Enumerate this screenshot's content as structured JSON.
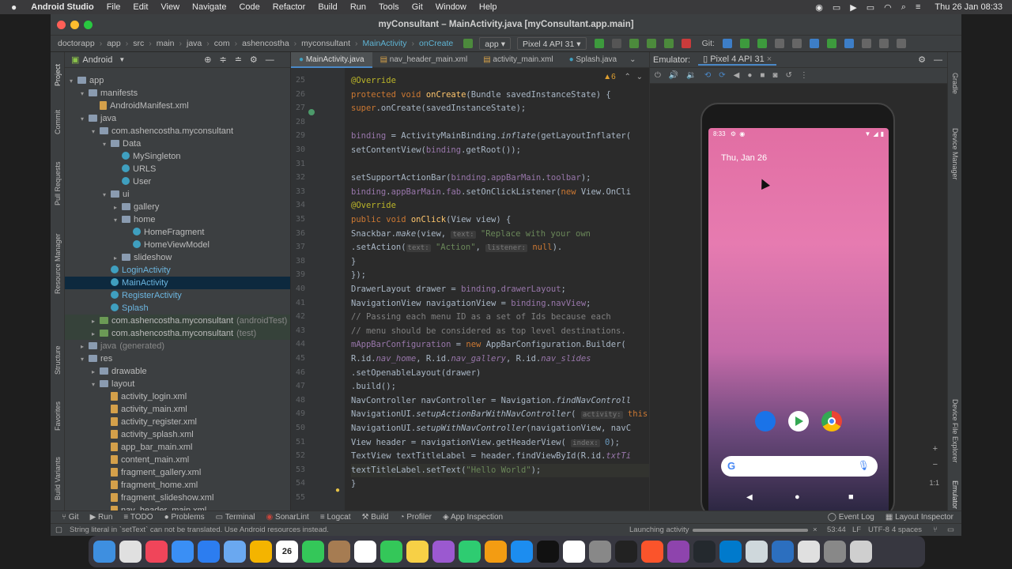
{
  "menubar": {
    "app_name": "Android Studio",
    "items": [
      "File",
      "Edit",
      "View",
      "Navigate",
      "Code",
      "Refactor",
      "Build",
      "Run",
      "Tools",
      "Git",
      "Window",
      "Help"
    ],
    "clock": "Thu 26 Jan  08:33"
  },
  "window": {
    "title": "myConsultant – MainActivity.java [myConsultant.app.main]"
  },
  "navbar": {
    "crumbs": [
      "doctorapp",
      "app",
      "src",
      "main",
      "java",
      "com",
      "ashencostha",
      "myconsultant",
      "MainActivity",
      "onCreate"
    ],
    "run_config": "app",
    "device": "Pixel 4 API 31",
    "git_label": "Git:"
  },
  "left_strip": {
    "tabs": [
      "Project",
      "Commit",
      "Pull Requests",
      "Resource Manager",
      "Structure",
      "Favorites",
      "Build Variants"
    ]
  },
  "right_strip": {
    "tabs": [
      "Gradle",
      "Device Manager",
      "Device File Explorer",
      "Emulator"
    ]
  },
  "project": {
    "view_mode": "Android",
    "tree": [
      {
        "label": "app",
        "indent": 0,
        "arrow": "▾",
        "icon": "folder",
        "state": ""
      },
      {
        "label": "manifests",
        "indent": 1,
        "arrow": "▾",
        "icon": "folder",
        "state": ""
      },
      {
        "label": "AndroidManifest.xml",
        "indent": 2,
        "arrow": "",
        "icon": "xml",
        "state": ""
      },
      {
        "label": "java",
        "indent": 1,
        "arrow": "▾",
        "icon": "folder",
        "state": ""
      },
      {
        "label": "com.ashencostha.myconsultant",
        "indent": 2,
        "arrow": "▾",
        "icon": "folder",
        "state": ""
      },
      {
        "label": "Data",
        "indent": 3,
        "arrow": "▾",
        "icon": "folder",
        "state": ""
      },
      {
        "label": "MySingleton",
        "indent": 4,
        "arrow": "",
        "icon": "class",
        "state": ""
      },
      {
        "label": "URLS",
        "indent": 4,
        "arrow": "",
        "icon": "class",
        "state": ""
      },
      {
        "label": "User",
        "indent": 4,
        "arrow": "",
        "icon": "class",
        "state": ""
      },
      {
        "label": "ui",
        "indent": 3,
        "arrow": "▾",
        "icon": "folder",
        "state": ""
      },
      {
        "label": "gallery",
        "indent": 4,
        "arrow": "▸",
        "icon": "folder",
        "state": ""
      },
      {
        "label": "home",
        "indent": 4,
        "arrow": "▾",
        "icon": "folder",
        "state": ""
      },
      {
        "label": "HomeFragment",
        "indent": 5,
        "arrow": "",
        "icon": "class",
        "state": ""
      },
      {
        "label": "HomeViewModel",
        "indent": 5,
        "arrow": "",
        "icon": "class",
        "state": ""
      },
      {
        "label": "slideshow",
        "indent": 4,
        "arrow": "▸",
        "icon": "folder",
        "state": ""
      },
      {
        "label": "LoginActivity",
        "indent": 3,
        "arrow": "",
        "icon": "class",
        "state": ""
      },
      {
        "label": "MainActivity",
        "indent": 3,
        "arrow": "",
        "icon": "class",
        "state": "sel"
      },
      {
        "label": "RegisterActivity",
        "indent": 3,
        "arrow": "",
        "icon": "class",
        "state": ""
      },
      {
        "label": "Splash",
        "indent": 3,
        "arrow": "",
        "icon": "class",
        "state": ""
      },
      {
        "label": "com.ashencostha.myconsultant",
        "suffix": "(androidTest)",
        "indent": 2,
        "arrow": "▸",
        "icon": "folder",
        "state": "test"
      },
      {
        "label": "com.ashencostha.myconsultant",
        "suffix": "(test)",
        "indent": 2,
        "arrow": "▸",
        "icon": "folder",
        "state": "test"
      },
      {
        "label": "java",
        "suffix": "(generated)",
        "indent": 1,
        "arrow": "▸",
        "icon": "folder",
        "state": "gen"
      },
      {
        "label": "res",
        "indent": 1,
        "arrow": "▾",
        "icon": "folder",
        "state": ""
      },
      {
        "label": "drawable",
        "indent": 2,
        "arrow": "▸",
        "icon": "folder",
        "state": ""
      },
      {
        "label": "layout",
        "indent": 2,
        "arrow": "▾",
        "icon": "folder",
        "state": ""
      },
      {
        "label": "activity_login.xml",
        "indent": 3,
        "arrow": "",
        "icon": "xml",
        "state": ""
      },
      {
        "label": "activity_main.xml",
        "indent": 3,
        "arrow": "",
        "icon": "xml",
        "state": ""
      },
      {
        "label": "activity_register.xml",
        "indent": 3,
        "arrow": "",
        "icon": "xml",
        "state": ""
      },
      {
        "label": "activity_splash.xml",
        "indent": 3,
        "arrow": "",
        "icon": "xml",
        "state": ""
      },
      {
        "label": "app_bar_main.xml",
        "indent": 3,
        "arrow": "",
        "icon": "xml",
        "state": ""
      },
      {
        "label": "content_main.xml",
        "indent": 3,
        "arrow": "",
        "icon": "xml",
        "state": ""
      },
      {
        "label": "fragment_gallery.xml",
        "indent": 3,
        "arrow": "",
        "icon": "xml",
        "state": ""
      },
      {
        "label": "fragment_home.xml",
        "indent": 3,
        "arrow": "",
        "icon": "xml",
        "state": ""
      },
      {
        "label": "fragment_slideshow.xml",
        "indent": 3,
        "arrow": "",
        "icon": "xml",
        "state": ""
      },
      {
        "label": "nav_header_main.xml",
        "indent": 3,
        "arrow": "",
        "icon": "xml",
        "state": ""
      }
    ]
  },
  "editor": {
    "tabs": [
      {
        "label": "MainActivity.java",
        "active": true
      },
      {
        "label": "nav_header_main.xml",
        "active": false
      },
      {
        "label": "activity_main.xml",
        "active": false
      },
      {
        "label": "Splash.java",
        "active": false
      }
    ],
    "warnings": "6",
    "lines": [
      {
        "n": "25",
        "html": "<span class='an'>@Override</span>"
      },
      {
        "n": "26",
        "html": "<span class='kw'>protected void </span><span class='fn'>onCreate</span>(Bundle savedInstanceState) {"
      },
      {
        "n": "27",
        "html": "    <span class='kw'>super</span>.onCreate(savedInstanceState);"
      },
      {
        "n": "28",
        "html": ""
      },
      {
        "n": "29",
        "html": "    <span class='fd'>binding</span> = ActivityMainBinding.<span class='it'>inflate</span>(getLayoutInflater("
      },
      {
        "n": "30",
        "html": "    setContentView(<span class='fd'>binding</span>.getRoot());"
      },
      {
        "n": "31",
        "html": ""
      },
      {
        "n": "32",
        "html": "    setSupportActionBar(<span class='fd'>binding</span>.<span class='fd'>appBarMain</span>.<span class='fd'>toolbar</span>);"
      },
      {
        "n": "33",
        "html": "    <span class='fd'>binding</span>.<span class='fd'>appBarMain</span>.<span class='fd'>fab</span>.setOnClickListener(<span class='kw'>new </span>View.OnCli"
      },
      {
        "n": "34",
        "html": "        <span class='an'>@Override</span>"
      },
      {
        "n": "35",
        "html": "        <span class='kw'>public void </span><span class='fn'>onClick</span>(View view) {"
      },
      {
        "n": "36",
        "html": "            Snackbar.<span class='it'>make</span>(view, <span class='hint'>text:</span> <span class='st'>\"Replace with your own</span>"
      },
      {
        "n": "37",
        "html": "                    .setAction(<span class='hint'>text:</span> <span class='st'>\"Action\"</span>, <span class='hint'>listener:</span> <span class='kw'>null</span>)."
      },
      {
        "n": "38",
        "html": "        }"
      },
      {
        "n": "39",
        "html": "    });"
      },
      {
        "n": "40",
        "html": "    DrawerLayout drawer = <span class='fd'>binding</span>.<span class='fd'>drawerLayout</span>;"
      },
      {
        "n": "41",
        "html": "    NavigationView navigationView = <span class='fd'>binding</span>.<span class='fd'>navView</span>;"
      },
      {
        "n": "42",
        "html": "    <span class='cm'>// Passing each menu ID as a set of Ids because each</span>"
      },
      {
        "n": "43",
        "html": "    <span class='cm'>// menu should be considered as top level destinations.</span>"
      },
      {
        "n": "44",
        "html": "    <span class='fd'>mAppBarConfiguration</span> = <span class='kw'>new </span>AppBarConfiguration.Builder("
      },
      {
        "n": "45",
        "html": "            R.id.<span class='fd it'>nav_home</span>, R.id.<span class='fd it'>nav_gallery</span>, R.id.<span class='fd it'>nav_slides</span>"
      },
      {
        "n": "46",
        "html": "            .setOpenableLayout(drawer)"
      },
      {
        "n": "47",
        "html": "            .build();"
      },
      {
        "n": "48",
        "html": "    NavController navController = Navigation.<span class='it'>findNavControll</span>"
      },
      {
        "n": "49",
        "html": "    NavigationUI.<span class='it'>setupActionBarWithNavController</span>( <span class='hint'>activity:</span> <span class='kw'>this</span>"
      },
      {
        "n": "50",
        "html": "    NavigationUI.<span class='it'>setupWithNavController</span>(navigationView, navC"
      },
      {
        "n": "51",
        "html": "    View header = navigationView.getHeaderView( <span class='hint'>index:</span> <span style='color:#6897bb'>0</span>);"
      },
      {
        "n": "52",
        "html": "    TextView textTitleLabel = header.findViewById(R.id.<span class='fd it'>txtTi</span>"
      },
      {
        "n": "53",
        "html": "    textTitleLabel.setText(<span class='st'>\"Hello World\"</span>);"
      },
      {
        "n": "54",
        "html": "}"
      },
      {
        "n": "55",
        "html": ""
      }
    ]
  },
  "emulator": {
    "tab_label": "Emulator:",
    "device_tab": "Pixel 4 API 31",
    "phone": {
      "time": "8:33",
      "date": "Thu, Jan 26"
    },
    "zoom_label": "1:1"
  },
  "bottom_tabs": [
    "Git",
    "Run",
    "TODO",
    "Problems",
    "Terminal",
    "SonarLint",
    "Logcat",
    "Build",
    "Profiler",
    "App Inspection"
  ],
  "bottom_right": [
    "Event Log",
    "Layout Inspector"
  ],
  "status": {
    "message": "String literal in `setText` can not be translated. Use Android resources instead.",
    "progress": "Launching activity",
    "position": "53:44",
    "line_sep": "LF",
    "encoding": "UTF-8",
    "indent": "4 spaces"
  },
  "dock": {
    "calendar_day": "26",
    "apps": [
      "finder",
      "launchpad",
      "music",
      "mail",
      "safari",
      "photos-ish",
      "photos",
      "calendar",
      "messages",
      "keychain",
      "reminders",
      "facetime",
      "notes",
      "podcasts",
      "numbers",
      "pages",
      "app-store",
      "tv",
      "chrome",
      "system-preferences",
      "terminal",
      "brave",
      "feedback",
      "github",
      "vscode",
      "preview",
      "xcode-like",
      "document",
      "help",
      "trash"
    ]
  },
  "colors": {
    "accent": "#4a88c7",
    "selection": "#0d293e",
    "panel": "#3c3f41",
    "editor": "#2b2b2b"
  }
}
